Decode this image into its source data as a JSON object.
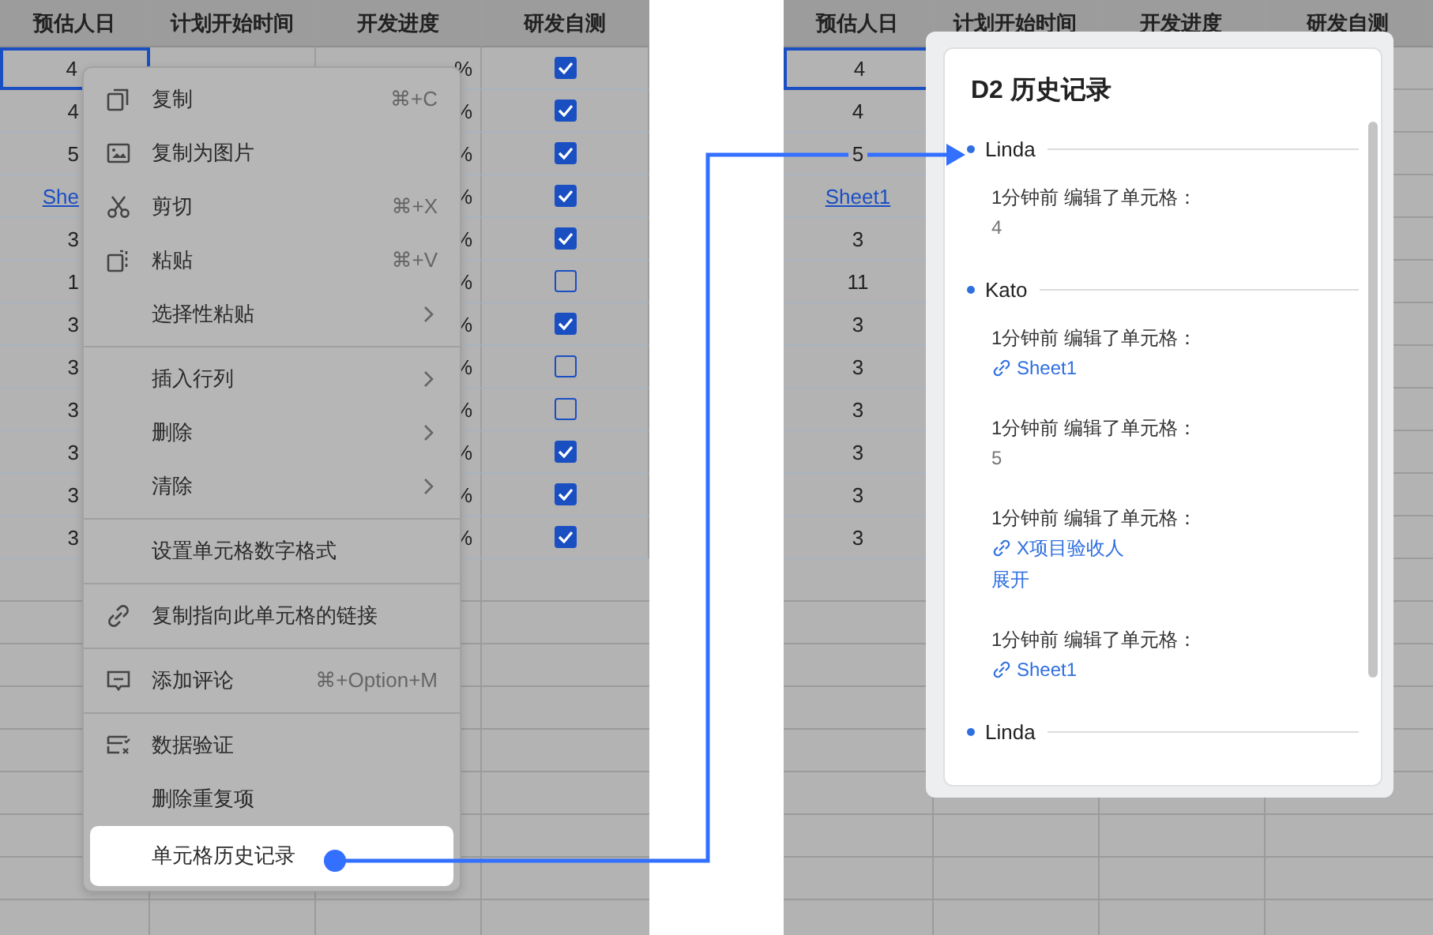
{
  "left_sheet": {
    "columns": [
      "预估人日",
      "计划开始时间",
      "开发进度",
      "研发自测"
    ],
    "rows": [
      {
        "selected": true,
        "days": {
          "text": "4",
          "kind": "text"
        },
        "progress": "%",
        "checked": true
      },
      {
        "selected": false,
        "days": {
          "text": "4",
          "kind": "text"
        },
        "progress": "%",
        "checked": true
      },
      {
        "selected": false,
        "days": {
          "text": "5",
          "kind": "text"
        },
        "progress": "%",
        "checked": true
      },
      {
        "selected": false,
        "days": {
          "text": "She",
          "kind": "link"
        },
        "progress": "%",
        "checked": true
      },
      {
        "selected": false,
        "days": {
          "text": "3",
          "kind": "text"
        },
        "progress": "%",
        "checked": true
      },
      {
        "selected": false,
        "days": {
          "text": "1",
          "kind": "text"
        },
        "progress": "%",
        "checked": false
      },
      {
        "selected": false,
        "days": {
          "text": "3",
          "kind": "text"
        },
        "progress": "%",
        "checked": true
      },
      {
        "selected": false,
        "days": {
          "text": "3",
          "kind": "text"
        },
        "progress": "%",
        "checked": false
      },
      {
        "selected": false,
        "days": {
          "text": "3",
          "kind": "text"
        },
        "progress": "%",
        "checked": false
      },
      {
        "selected": false,
        "days": {
          "text": "3",
          "kind": "text"
        },
        "progress": "%",
        "checked": true
      },
      {
        "selected": false,
        "days": {
          "text": "3",
          "kind": "text"
        },
        "progress": "%",
        "checked": true
      },
      {
        "selected": false,
        "days": {
          "text": "3",
          "kind": "text"
        },
        "progress": "%",
        "checked": true
      }
    ]
  },
  "context_menu": {
    "groups": [
      [
        {
          "label": "复制",
          "kind": "copy",
          "shortcut": "⌘+C",
          "submenu": false,
          "selected": false
        },
        {
          "label": "复制为图片",
          "kind": "image",
          "submenu": false,
          "selected": false
        },
        {
          "label": "剪切",
          "kind": "cut",
          "shortcut": "⌘+X",
          "submenu": false,
          "selected": false
        },
        {
          "label": "粘贴",
          "kind": "paste",
          "shortcut": "⌘+V",
          "submenu": false,
          "selected": false
        },
        {
          "label": "选择性粘贴",
          "kind": "plain",
          "submenu": true,
          "selected": false
        }
      ],
      [
        {
          "label": "插入行列",
          "kind": "plain",
          "submenu": true,
          "selected": false
        },
        {
          "label": "删除",
          "kind": "plain",
          "submenu": true,
          "selected": false
        },
        {
          "label": "清除",
          "kind": "plain",
          "submenu": true,
          "selected": false
        }
      ],
      [
        {
          "label": "设置单元格数字格式",
          "kind": "plain",
          "submenu": false,
          "selected": false
        }
      ],
      [
        {
          "label": "复制指向此单元格的链接",
          "kind": "link",
          "submenu": false,
          "selected": false
        }
      ],
      [
        {
          "label": "添加评论",
          "kind": "comment",
          "shortcut": "⌘+Option+M",
          "submenu": false,
          "selected": false
        }
      ],
      [
        {
          "label": "数据验证",
          "kind": "validate",
          "submenu": false,
          "selected": false
        },
        {
          "label": "删除重复项",
          "kind": "plain",
          "submenu": false,
          "selected": false
        },
        {
          "label": "单元格历史记录",
          "kind": "plain",
          "submenu": false,
          "selected": true
        }
      ]
    ]
  },
  "right_sheet": {
    "columns": [
      "预估人日",
      "计划开始时间",
      "开发进度",
      "研发自测"
    ],
    "rows": [
      {
        "selected": true,
        "days": {
          "text": "4",
          "kind": "text"
        }
      },
      {
        "selected": false,
        "days": {
          "text": "4",
          "kind": "text"
        }
      },
      {
        "selected": false,
        "days": {
          "text": "5",
          "kind": "text"
        }
      },
      {
        "selected": false,
        "days": {
          "text": "Sheet1",
          "kind": "link"
        }
      },
      {
        "selected": false,
        "days": {
          "text": "3",
          "kind": "text"
        }
      },
      {
        "selected": false,
        "days": {
          "text": "11",
          "kind": "text"
        }
      },
      {
        "selected": false,
        "days": {
          "text": "3",
          "kind": "text"
        }
      },
      {
        "selected": false,
        "days": {
          "text": "3",
          "kind": "text"
        }
      },
      {
        "selected": false,
        "days": {
          "text": "3",
          "kind": "text"
        }
      },
      {
        "selected": false,
        "days": {
          "text": "3",
          "kind": "text"
        }
      },
      {
        "selected": false,
        "days": {
          "text": "3",
          "kind": "text"
        }
      },
      {
        "selected": false,
        "days": {
          "text": "3",
          "kind": "text"
        }
      }
    ]
  },
  "history_panel": {
    "title": "D2 历史记录",
    "entries": [
      {
        "user": "Linda",
        "edits": [
          {
            "time": "1分钟前 编辑了单元格：",
            "value": {
              "kind": "text",
              "text": "4"
            }
          }
        ]
      },
      {
        "user": "Kato",
        "edits": [
          {
            "time": "1分钟前 编辑了单元格：",
            "value": {
              "kind": "link",
              "text": "Sheet1"
            }
          },
          {
            "time": "1分钟前 编辑了单元格：",
            "value": {
              "kind": "text",
              "text": "5"
            }
          },
          {
            "time": "1分钟前 编辑了单元格：",
            "value": {
              "kind": "link",
              "text": "X项目验收人"
            },
            "expand": "展开"
          },
          {
            "time": "1分钟前 编辑了单元格：",
            "value": {
              "kind": "link",
              "text": "Sheet1"
            }
          }
        ]
      },
      {
        "user": "Linda"
      }
    ]
  }
}
